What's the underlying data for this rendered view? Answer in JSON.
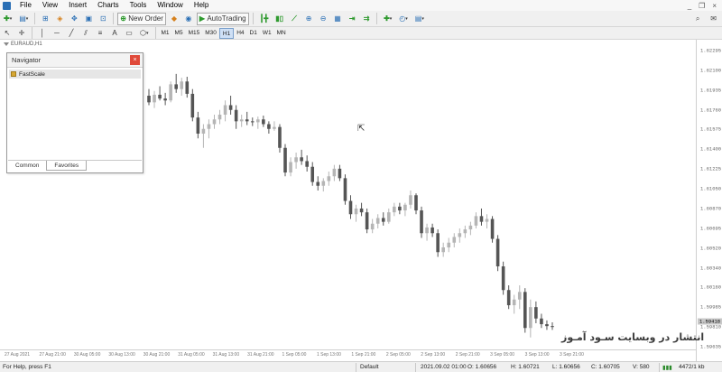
{
  "menu": [
    "File",
    "View",
    "Insert",
    "Charts",
    "Tools",
    "Window",
    "Help"
  ],
  "toolbar": {
    "new_order": "New Order",
    "autotrading": "AutoTrading"
  },
  "timeframes": [
    "M1",
    "M5",
    "M15",
    "M30",
    "H1",
    "H4",
    "D1",
    "W1",
    "MN"
  ],
  "active_timeframe": "H1",
  "chart": {
    "symbol_label": "EURAUD,H1",
    "price_labels": [
      "1.62295",
      "1.62100",
      "1.61935",
      "1.61760",
      "1.61575",
      "1.61400",
      "1.61225",
      "1.61050",
      "1.60870",
      "1.60695",
      "1.60520",
      "1.60340",
      "1.60160",
      "1.59985",
      "1.59810",
      "1.59635"
    ],
    "current_price": "1.59418",
    "time_labels": [
      "27 Aug 2021",
      "27 Aug 21:00",
      "30 Aug 05:00",
      "30 Aug 13:00",
      "30 Aug 21:00",
      "31 Aug 05:00",
      "31 Aug 13:00",
      "31 Aug 21:00",
      "1 Sep 05:00",
      "1 Sep 13:00",
      "1 Sep 21:00",
      "2 Sep 05:00",
      "2 Sep 13:00",
      "2 Sep 21:00",
      "3 Sep 05:00",
      "3 Sep 13:00",
      "3 Sep 21:00"
    ],
    "watermark": "انتشار در وبسایت سـود آمـوز"
  },
  "navigator": {
    "title": "Navigator",
    "items": [
      "FastScale"
    ],
    "tabs": [
      "Common",
      "Favorites"
    ],
    "active_tab": "Favorites"
  },
  "status": {
    "help": "For Help, press F1",
    "profile": "Default",
    "datetime": "2021.09.02 01:00",
    "open": "O: 1.60656",
    "high": "H: 1.60721",
    "low": "L: 1.60656",
    "close": "C: 1.60705",
    "volume": "V: 580",
    "traffic": "4472/1 kb"
  },
  "chart_data": {
    "type": "candlestick",
    "title": "EURAUD,H1",
    "candle_color_up": "#b5b5b5",
    "candle_color_down": "#555555",
    "ohlc": [
      [
        1.6185,
        1.6192,
        1.6175,
        1.6178
      ],
      [
        1.6178,
        1.619,
        1.6172,
        1.6186
      ],
      [
        1.6186,
        1.6195,
        1.618,
        1.6182
      ],
      [
        1.6182,
        1.6188,
        1.6175,
        1.618
      ],
      [
        1.618,
        1.62,
        1.6178,
        1.6197
      ],
      [
        1.6197,
        1.6208,
        1.6188,
        1.6192
      ],
      [
        1.6192,
        1.6204,
        1.6185,
        1.62
      ],
      [
        1.62,
        1.6205,
        1.6183,
        1.6187
      ],
      [
        1.6187,
        1.6192,
        1.6158,
        1.6162
      ],
      [
        1.6162,
        1.6168,
        1.614,
        1.6145
      ],
      [
        1.6145,
        1.6155,
        1.613,
        1.615
      ],
      [
        1.615,
        1.616,
        1.614,
        1.6155
      ],
      [
        1.6155,
        1.6165,
        1.615,
        1.616
      ],
      [
        1.616,
        1.617,
        1.6155,
        1.6165
      ],
      [
        1.6165,
        1.618,
        1.6158,
        1.6175
      ],
      [
        1.6175,
        1.6185,
        1.6165,
        1.617
      ],
      [
        1.617,
        1.6175,
        1.615,
        1.6158
      ],
      [
        1.6158,
        1.6165,
        1.6152,
        1.616
      ],
      [
        1.616,
        1.6168,
        1.6154,
        1.6158
      ],
      [
        1.6158,
        1.6162,
        1.6153,
        1.6157
      ],
      [
        1.6157,
        1.6163,
        1.615,
        1.616
      ],
      [
        1.616,
        1.6164,
        1.6152,
        1.6155
      ],
      [
        1.6155,
        1.6158,
        1.6145,
        1.615
      ],
      [
        1.615,
        1.6158,
        1.6148,
        1.6152
      ],
      [
        1.6152,
        1.6155,
        1.6125,
        1.613
      ],
      [
        1.613,
        1.6134,
        1.61,
        1.6104
      ],
      [
        1.6104,
        1.612,
        1.61,
        1.6115
      ],
      [
        1.6115,
        1.6125,
        1.6108,
        1.612
      ],
      [
        1.612,
        1.6128,
        1.6112,
        1.6116
      ],
      [
        1.6116,
        1.6122,
        1.6105,
        1.611
      ],
      [
        1.611,
        1.6115,
        1.609,
        1.6094
      ],
      [
        1.6094,
        1.61,
        1.6085,
        1.609
      ],
      [
        1.609,
        1.6098,
        1.6084,
        1.6095
      ],
      [
        1.6095,
        1.6105,
        1.609,
        1.61
      ],
      [
        1.61,
        1.6112,
        1.6095,
        1.6108
      ],
      [
        1.6108,
        1.6112,
        1.6095,
        1.6098
      ],
      [
        1.6098,
        1.6102,
        1.607,
        1.6074
      ],
      [
        1.6074,
        1.608,
        1.6055,
        1.606
      ],
      [
        1.606,
        1.607,
        1.6052,
        1.6066
      ],
      [
        1.6066,
        1.6072,
        1.6058,
        1.6062
      ],
      [
        1.6062,
        1.6066,
        1.604,
        1.6044
      ],
      [
        1.6044,
        1.6055,
        1.604,
        1.605
      ],
      [
        1.605,
        1.606,
        1.6045,
        1.6056
      ],
      [
        1.6056,
        1.6062,
        1.6048,
        1.6052
      ],
      [
        1.6052,
        1.6066,
        1.605,
        1.6062
      ],
      [
        1.6062,
        1.6072,
        1.6058,
        1.6068
      ],
      [
        1.6068,
        1.6072,
        1.606,
        1.6064
      ],
      [
        1.6064,
        1.6072,
        1.6058,
        1.607
      ],
      [
        1.607,
        1.6085,
        1.6066,
        1.608
      ],
      [
        1.608,
        1.6082,
        1.606,
        1.6064
      ],
      [
        1.6064,
        1.6068,
        1.6035,
        1.604
      ],
      [
        1.604,
        1.605,
        1.6032,
        1.6046
      ],
      [
        1.6046,
        1.605,
        1.6036,
        1.604
      ],
      [
        1.604,
        1.6044,
        1.6015,
        1.602
      ],
      [
        1.602,
        1.603,
        1.6015,
        1.6025
      ],
      [
        1.6025,
        1.6035,
        1.602,
        1.603
      ],
      [
        1.603,
        1.604,
        1.6025,
        1.6036
      ],
      [
        1.6036,
        1.6045,
        1.603,
        1.604
      ],
      [
        1.604,
        1.6048,
        1.6035,
        1.6044
      ],
      [
        1.6044,
        1.6052,
        1.6038,
        1.6048
      ],
      [
        1.6048,
        1.6062,
        1.6045,
        1.6058
      ],
      [
        1.6058,
        1.6066,
        1.6048,
        1.6052
      ],
      [
        1.6052,
        1.606,
        1.6045,
        1.6055
      ],
      [
        1.6055,
        1.6058,
        1.603,
        1.6034
      ],
      [
        1.6034,
        1.6038,
        1.6,
        1.6005
      ],
      [
        1.6005,
        1.601,
        1.5975,
        1.598
      ],
      [
        1.598,
        1.5985,
        1.596,
        1.5964
      ],
      [
        1.5964,
        1.5975,
        1.5955,
        1.597
      ],
      [
        1.597,
        1.5985,
        1.596,
        1.5978
      ],
      [
        1.5978,
        1.5982,
        1.5935,
        1.594
      ],
      [
        1.594,
        1.597,
        1.593,
        1.5962
      ],
      [
        1.5962,
        1.5968,
        1.5945,
        1.595
      ],
      [
        1.595,
        1.5955,
        1.594,
        1.5944
      ],
      [
        1.5944,
        1.5948,
        1.5938,
        1.5942
      ],
      [
        1.5942,
        1.5946,
        1.5938,
        1.5941
      ]
    ]
  }
}
